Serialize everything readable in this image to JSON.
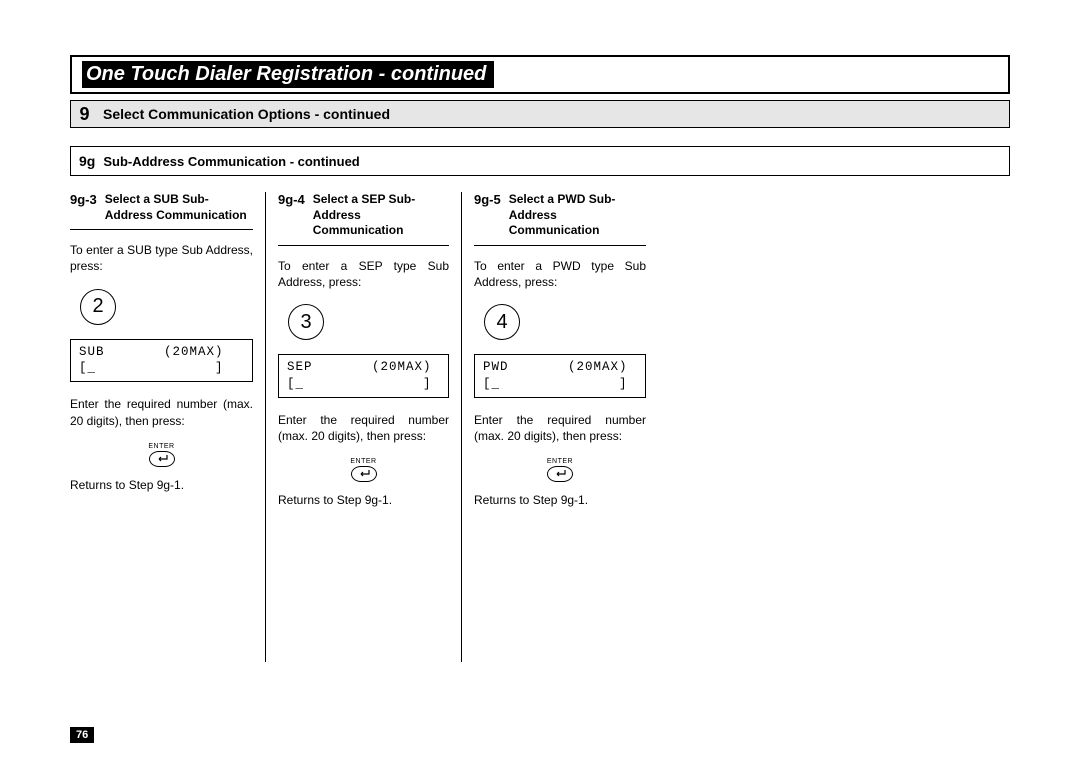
{
  "page_number": "76",
  "title": "One Touch Dialer Registration - continued",
  "step9": {
    "number": "9",
    "text": "Select Communication Options - continued"
  },
  "sub_header": {
    "number": "9g",
    "text": "Sub-Address Communication - continued"
  },
  "columns": [
    {
      "num": "9g-3",
      "title": "Select a SUB Sub-Address Communication",
      "intro": "To enter a SUB type Sub Address, press:",
      "key": "2",
      "lcd_line1": "SUB       (20MAX)",
      "lcd_line2": "[_              ]",
      "after": "Enter the required number (max. 20 digits), then press:",
      "enter_label": "ENTER",
      "returns": "Returns to Step 9g-1."
    },
    {
      "num": "9g-4",
      "title": "Select a SEP Sub-Address Communication",
      "intro": "To enter a SEP type Sub Address, press:",
      "key": "3",
      "lcd_line1": "SEP       (20MAX)",
      "lcd_line2": "[_              ]",
      "after": "Enter the required number (max. 20 digits), then press:",
      "enter_label": "ENTER",
      "returns": "Returns to Step 9g-1."
    },
    {
      "num": "9g-5",
      "title": "Select a PWD Sub-Address Communication",
      "intro": "To enter a PWD type Sub Address, press:",
      "key": "4",
      "lcd_line1": "PWD       (20MAX)",
      "lcd_line2": "[_              ]",
      "after": "Enter the required number (max. 20 digits), then press:",
      "enter_label": "ENTER",
      "returns": "Returns to Step 9g-1."
    }
  ]
}
